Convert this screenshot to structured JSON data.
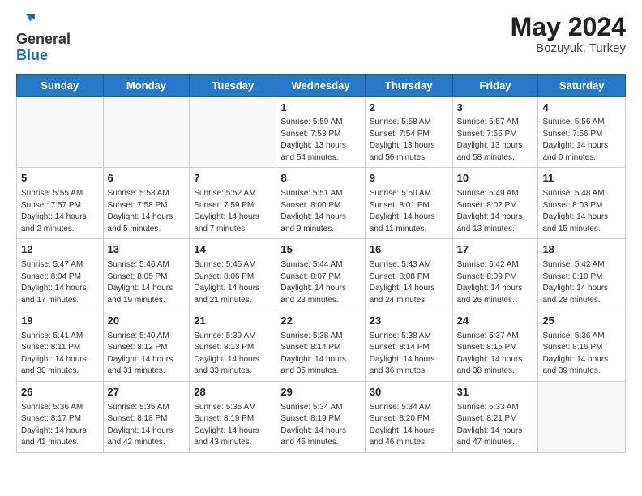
{
  "header": {
    "logo_general": "General",
    "logo_blue": "Blue",
    "month_year": "May 2024",
    "location": "Bozuyuk, Turkey"
  },
  "days_of_week": [
    "Sunday",
    "Monday",
    "Tuesday",
    "Wednesday",
    "Thursday",
    "Friday",
    "Saturday"
  ],
  "weeks": [
    [
      {
        "day": "",
        "info": ""
      },
      {
        "day": "",
        "info": ""
      },
      {
        "day": "",
        "info": ""
      },
      {
        "day": "1",
        "info": "Sunrise: 5:59 AM\nSunset: 7:53 PM\nDaylight: 13 hours and 54 minutes."
      },
      {
        "day": "2",
        "info": "Sunrise: 5:58 AM\nSunset: 7:54 PM\nDaylight: 13 hours and 56 minutes."
      },
      {
        "day": "3",
        "info": "Sunrise: 5:57 AM\nSunset: 7:55 PM\nDaylight: 13 hours and 58 minutes."
      },
      {
        "day": "4",
        "info": "Sunrise: 5:56 AM\nSunset: 7:56 PM\nDaylight: 14 hours and 0 minutes."
      }
    ],
    [
      {
        "day": "5",
        "info": "Sunrise: 5:55 AM\nSunset: 7:57 PM\nDaylight: 14 hours and 2 minutes."
      },
      {
        "day": "6",
        "info": "Sunrise: 5:53 AM\nSunset: 7:58 PM\nDaylight: 14 hours and 5 minutes."
      },
      {
        "day": "7",
        "info": "Sunrise: 5:52 AM\nSunset: 7:59 PM\nDaylight: 14 hours and 7 minutes."
      },
      {
        "day": "8",
        "info": "Sunrise: 5:51 AM\nSunset: 8:00 PM\nDaylight: 14 hours and 9 minutes."
      },
      {
        "day": "9",
        "info": "Sunrise: 5:50 AM\nSunset: 8:01 PM\nDaylight: 14 hours and 11 minutes."
      },
      {
        "day": "10",
        "info": "Sunrise: 5:49 AM\nSunset: 8:02 PM\nDaylight: 14 hours and 13 minutes."
      },
      {
        "day": "11",
        "info": "Sunrise: 5:48 AM\nSunset: 8:03 PM\nDaylight: 14 hours and 15 minutes."
      }
    ],
    [
      {
        "day": "12",
        "info": "Sunrise: 5:47 AM\nSunset: 8:04 PM\nDaylight: 14 hours and 17 minutes."
      },
      {
        "day": "13",
        "info": "Sunrise: 5:46 AM\nSunset: 8:05 PM\nDaylight: 14 hours and 19 minutes."
      },
      {
        "day": "14",
        "info": "Sunrise: 5:45 AM\nSunset: 8:06 PM\nDaylight: 14 hours and 21 minutes."
      },
      {
        "day": "15",
        "info": "Sunrise: 5:44 AM\nSunset: 8:07 PM\nDaylight: 14 hours and 23 minutes."
      },
      {
        "day": "16",
        "info": "Sunrise: 5:43 AM\nSunset: 8:08 PM\nDaylight: 14 hours and 24 minutes."
      },
      {
        "day": "17",
        "info": "Sunrise: 5:42 AM\nSunset: 8:09 PM\nDaylight: 14 hours and 26 minutes."
      },
      {
        "day": "18",
        "info": "Sunrise: 5:42 AM\nSunset: 8:10 PM\nDaylight: 14 hours and 28 minutes."
      }
    ],
    [
      {
        "day": "19",
        "info": "Sunrise: 5:41 AM\nSunset: 8:11 PM\nDaylight: 14 hours and 30 minutes."
      },
      {
        "day": "20",
        "info": "Sunrise: 5:40 AM\nSunset: 8:12 PM\nDaylight: 14 hours and 31 minutes."
      },
      {
        "day": "21",
        "info": "Sunrise: 5:39 AM\nSunset: 8:13 PM\nDaylight: 14 hours and 33 minutes."
      },
      {
        "day": "22",
        "info": "Sunrise: 5:38 AM\nSunset: 8:14 PM\nDaylight: 14 hours and 35 minutes."
      },
      {
        "day": "23",
        "info": "Sunrise: 5:38 AM\nSunset: 8:14 PM\nDaylight: 14 hours and 36 minutes."
      },
      {
        "day": "24",
        "info": "Sunrise: 5:37 AM\nSunset: 8:15 PM\nDaylight: 14 hours and 38 minutes."
      },
      {
        "day": "25",
        "info": "Sunrise: 5:36 AM\nSunset: 8:16 PM\nDaylight: 14 hours and 39 minutes."
      }
    ],
    [
      {
        "day": "26",
        "info": "Sunrise: 5:36 AM\nSunset: 8:17 PM\nDaylight: 14 hours and 41 minutes."
      },
      {
        "day": "27",
        "info": "Sunrise: 5:35 AM\nSunset: 8:18 PM\nDaylight: 14 hours and 42 minutes."
      },
      {
        "day": "28",
        "info": "Sunrise: 5:35 AM\nSunset: 8:19 PM\nDaylight: 14 hours and 43 minutes."
      },
      {
        "day": "29",
        "info": "Sunrise: 5:34 AM\nSunset: 8:19 PM\nDaylight: 14 hours and 45 minutes."
      },
      {
        "day": "30",
        "info": "Sunrise: 5:34 AM\nSunset: 8:20 PM\nDaylight: 14 hours and 46 minutes."
      },
      {
        "day": "31",
        "info": "Sunrise: 5:33 AM\nSunset: 8:21 PM\nDaylight: 14 hours and 47 minutes."
      },
      {
        "day": "",
        "info": ""
      }
    ]
  ]
}
